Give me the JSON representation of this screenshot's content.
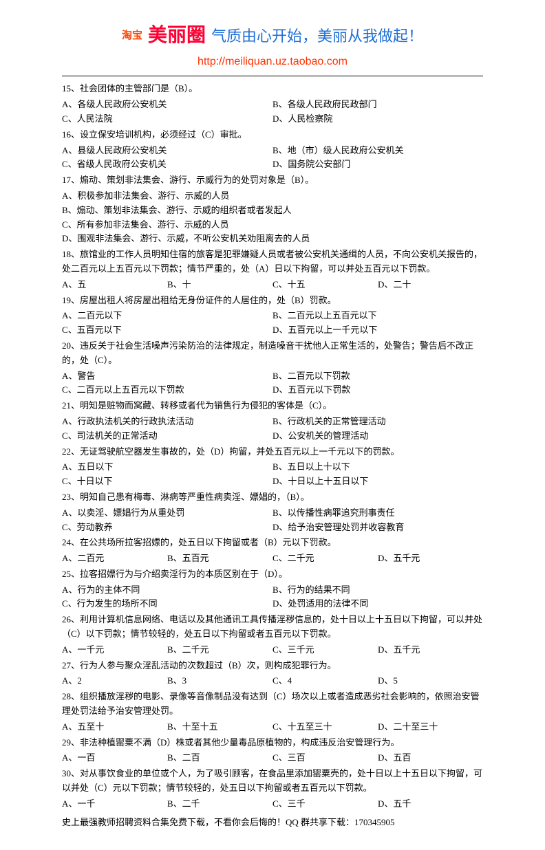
{
  "header": {
    "taobao": "淘宝",
    "brand": "美丽圈",
    "slogan": "气质由心开始，美丽从我做起！",
    "url": "http://meiliquan.uz.taobao.com"
  },
  "questions": [
    {
      "stem": "15、社会团体的主管部门是（B）。",
      "layout": "2",
      "opts": [
        "A、各级人民政府公安机关",
        "B、各级人民政府民政部门",
        "C、人民法院",
        "D、人民检察院"
      ]
    },
    {
      "stem": "16、设立保安培训机构，必须经过（C）审批。",
      "layout": "2",
      "opts": [
        "A、县级人民政府公安机关",
        "B、地（市）级人民政府公安机关",
        "C、省级人民政府公安机关",
        "D、国务院公安部门"
      ]
    },
    {
      "stem": "17、煽动、策划非法集会、游行、示威行为的处罚对象是（B）。",
      "layout": "1",
      "opts": [
        "A、积极参加非法集会、游行、示威的人员",
        "B、煽动、策划非法集会、游行、示威的组织者或者发起人",
        "C、所有参加非法集会、游行、示威的人员",
        "D、围观非法集会、游行、示威，不听公安机关劝阻离去的人员"
      ]
    },
    {
      "stem": "18、旅馆业的工作人员明知住宿的旅客是犯罪嫌疑人员或者被公安机关通缉的人员，不向公安机关报告的，处二百元以上五百元以下罚款；情节严重的，处（A）日以下拘留，可以并处五百元以下罚款。",
      "layout": "4",
      "opts": [
        "A、五",
        "B、十",
        "C、十五",
        "D、二十"
      ]
    },
    {
      "stem": "19、房屋出租人将房屋出租给无身份证件的人居住的，处（B）罚款。",
      "layout": "2",
      "opts": [
        "A、二百元以下",
        "B、二百元以上五百元以下",
        "C、五百元以下",
        "D、五百元以上一千元以下"
      ]
    },
    {
      "stem": "20、违反关于社会生活噪声污染防治的法律规定，制造噪音干扰他人正常生活的，处警告；警告后不改正的，处（C）。",
      "layout": "2",
      "opts": [
        "A、警告",
        "B、二百元以下罚款",
        "C、二百元以上五百元以下罚款",
        "D、五百元以下罚款"
      ]
    },
    {
      "stem": "21、明知是赃物而窝藏、转移或者代为销售行为侵犯的客体是（C）。",
      "layout": "2",
      "opts": [
        "A、行政执法机关的行政执法活动",
        "B、行政机关的正常管理活动",
        "C、司法机关的正常活动",
        "D、公安机关的管理活动"
      ]
    },
    {
      "stem": "22、无证驾驶航空器发生事故的，处（D）拘留，并处五百元以上一千元以下的罚款。",
      "layout": "2",
      "opts": [
        "A、五日以下",
        "B、五日以上十以下",
        "C、十日以下",
        "D、十日以上十五日以下"
      ]
    },
    {
      "stem": "23、明知自己患有梅毒、淋病等严重性病卖淫、嫖娼的，（B）。",
      "layout": "2",
      "opts": [
        "A、以卖淫、嫖娼行为从重处罚",
        "B、以传播性病罪追究刑事责任",
        "C、劳动教养",
        "D、给予治安管理处罚并收容教育"
      ]
    },
    {
      "stem": "24、在公共场所拉客招嫖的，处五日以下拘留或者（B）元以下罚款。",
      "layout": "4",
      "opts": [
        "A、二百元",
        "B、五百元",
        "C、二千元",
        "D、五千元"
      ]
    },
    {
      "stem": "25、拉客招嫖行为与介绍卖淫行为的本质区别在于（D）。",
      "layout": "2",
      "opts": [
        "A、行为的主体不同",
        "B、行为的结果不同",
        "C、行为发生的场所不同",
        "D、处罚适用的法律不同"
      ]
    },
    {
      "stem": "26、利用计算机信息网络、电话以及其他通讯工具传播淫秽信息的，处十日以上十五日以下拘留，可以并处（C）以下罚款；情节较轻的，处五日以下拘留或者五百元以下罚款。",
      "layout": "4",
      "opts": [
        "A、一千元",
        "B、二千元",
        "C、三千元",
        "D、五千元"
      ]
    },
    {
      "stem": "27、行为人参与聚众淫乱活动的次数超过（B）次，则构成犯罪行为。",
      "layout": "4",
      "opts": [
        "A、2",
        "B、3",
        "C、4",
        "D、5"
      ]
    },
    {
      "stem": "28、组织播放淫秽的电影、录像等音像制品没有达到（C）场次以上或者造成恶劣社会影响的，依照治安管理处罚法给予治安管理处罚。",
      "layout": "4",
      "opts": [
        "A、五至十",
        "B、十至十五",
        "C、十五至三十",
        "D、二十至三十"
      ]
    },
    {
      "stem": "29、非法种植罂粟不满（D）株或者其他少量毒品原植物的，构成违反治安管理行为。",
      "layout": "4",
      "opts": [
        "A、一百",
        "B、二百",
        "C、三百",
        "D、五百"
      ]
    },
    {
      "stem": "30、对从事饮食业的单位或个人，为了吸引顾客，在食品里添加罂粟壳的，处十日以上十五日以下拘留，可以并处（C）元以下罚款；情节较轻的，处五日以下拘留或者五百元以下罚款。",
      "layout": "4",
      "opts": [
        "A、一千",
        "B、二千",
        "C、三千",
        "D、五千"
      ]
    }
  ],
  "footer": "史上最强教师招聘资料合集免费下载，不看你会后悔的！QQ 群共享下载：170345905"
}
